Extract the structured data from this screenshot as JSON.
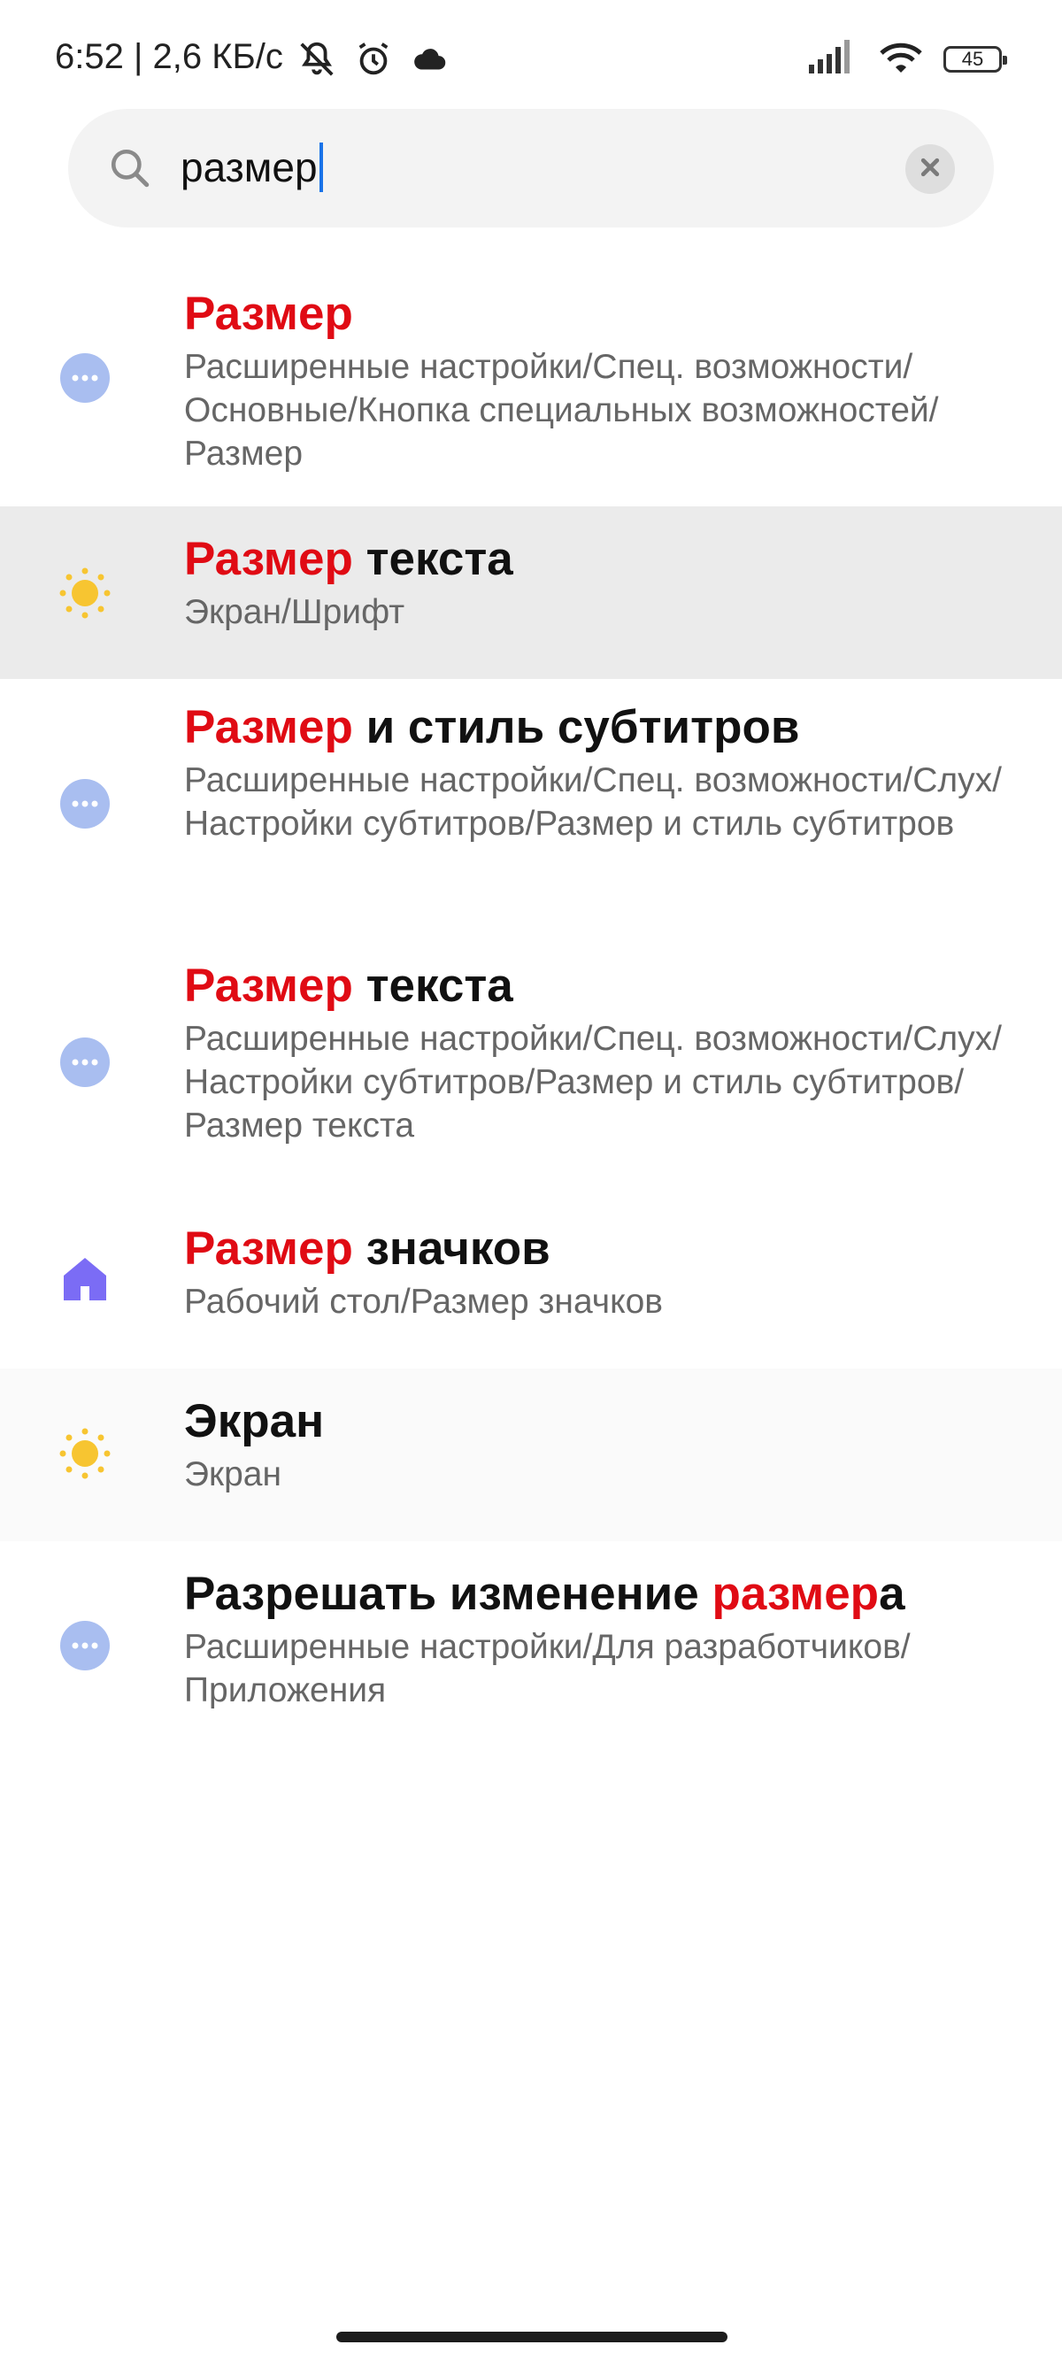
{
  "status_bar": {
    "time_speed": "6:52 | 2,6 КБ/с",
    "battery": "45"
  },
  "search": {
    "query": "размер"
  },
  "results": [
    {
      "title_hl": "Размер",
      "title_rest": "",
      "title_pre": "",
      "path": "Расширенные настройки/Спец. возможности/Основные/Кнопка специальных возможностей/Размер",
      "icon": "more-dots-icon"
    },
    {
      "title_hl": "Размер",
      "title_rest": " текста",
      "title_pre": "",
      "path": "Экран/Шрифт",
      "icon": "sun-icon"
    },
    {
      "title_hl": "Размер",
      "title_rest": " и стиль субтитров",
      "title_pre": "",
      "path": "Расширенные настройки/Спец. возможности/Слух/Настройки субтитров/Размер и стиль субтитров",
      "icon": "more-dots-icon"
    },
    {
      "title_hl": "Размер",
      "title_rest": " текста",
      "title_pre": "",
      "path": "Расширенные настройки/Спец. возможности/Слух/Настройки субтитров/Размер и стиль субтитров/Размер текста",
      "icon": "more-dots-icon"
    },
    {
      "title_hl": "Размер",
      "title_rest": " значков",
      "title_pre": "",
      "path": "Рабочий стол/Размер значков",
      "icon": "home-icon"
    },
    {
      "title_hl": "",
      "title_rest": "",
      "title_pre": "Экран",
      "path": "Экран",
      "icon": "sun-icon"
    },
    {
      "title_hl": "размер",
      "title_rest": "а",
      "title_pre": "Разрешать изменение ",
      "path": "Расширенные настройки/Для разработчиков/Приложения",
      "icon": "more-dots-icon"
    }
  ],
  "colors": {
    "highlight": "#e00b14",
    "dots_icon": "#a9bef0",
    "sun_icon": "#f7c531",
    "home_icon": "#7b6cf5"
  }
}
